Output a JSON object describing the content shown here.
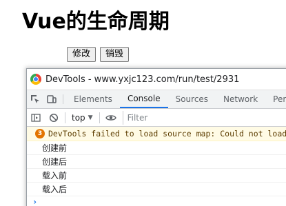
{
  "page": {
    "title": "Vue的生命周期",
    "buttons": {
      "update_label": "修改",
      "destroy_label": "销毁"
    }
  },
  "devtools": {
    "window_title": "DevTools - www.yxjc123.com/run/test/2931",
    "tabs": [
      {
        "label": "Elements",
        "active": false
      },
      {
        "label": "Console",
        "active": true
      },
      {
        "label": "Sources",
        "active": false
      },
      {
        "label": "Network",
        "active": false
      },
      {
        "label": "Perfo",
        "active": false
      }
    ],
    "toolbar": {
      "context": "top",
      "filter_placeholder": "Filter"
    },
    "warning": {
      "count": "3",
      "text": "DevTools failed to load source map: Could not load co"
    },
    "console_lines": [
      "创建前",
      "创建后",
      "载入前",
      "载入后"
    ],
    "prompt": "›",
    "colors": {
      "accent": "#1a73e8",
      "warning_bg": "#fffbe5",
      "warning_badge": "#e37400"
    }
  }
}
